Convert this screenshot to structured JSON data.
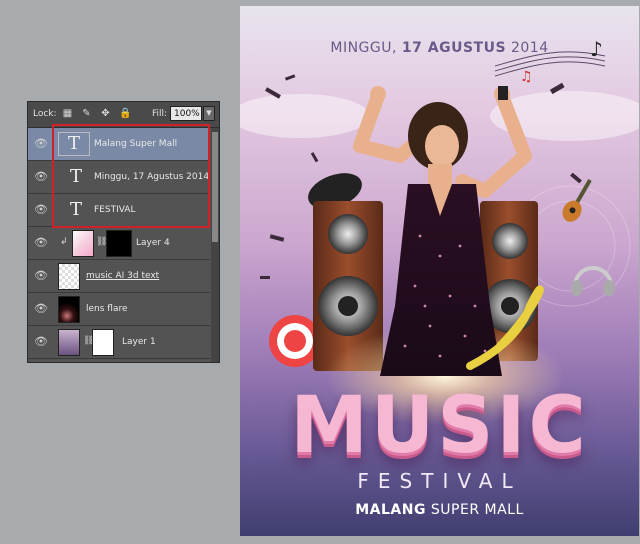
{
  "layers_panel": {
    "lock_label": "Lock:",
    "fill_label": "Fill:",
    "fill_value": "100%",
    "layers": [
      {
        "name": "Malang Super Mall",
        "type": "text",
        "selected": true
      },
      {
        "name": "Minggu, 17 Agustus 2014",
        "type": "text",
        "selected": false
      },
      {
        "name": "FESTIVAL",
        "type": "text",
        "selected": false
      },
      {
        "name": "Layer 4",
        "type": "image",
        "selected": false
      },
      {
        "name": "music AI 3d text",
        "type": "smart-object",
        "selected": false
      },
      {
        "name": "lens flare",
        "type": "image",
        "selected": false
      },
      {
        "name": "Layer 1",
        "type": "image",
        "selected": false
      }
    ],
    "text_glyph": "T",
    "highlight_color": "#d0202a"
  },
  "poster": {
    "date_prefix": "MINGGU, ",
    "date_bold": "17 AGUSTUS",
    "date_suffix": " 2014",
    "title": "MUSIC",
    "subtitle": "FESTIVAL",
    "venue_bold": "MALANG",
    "venue_rest": " SUPER MALL"
  }
}
